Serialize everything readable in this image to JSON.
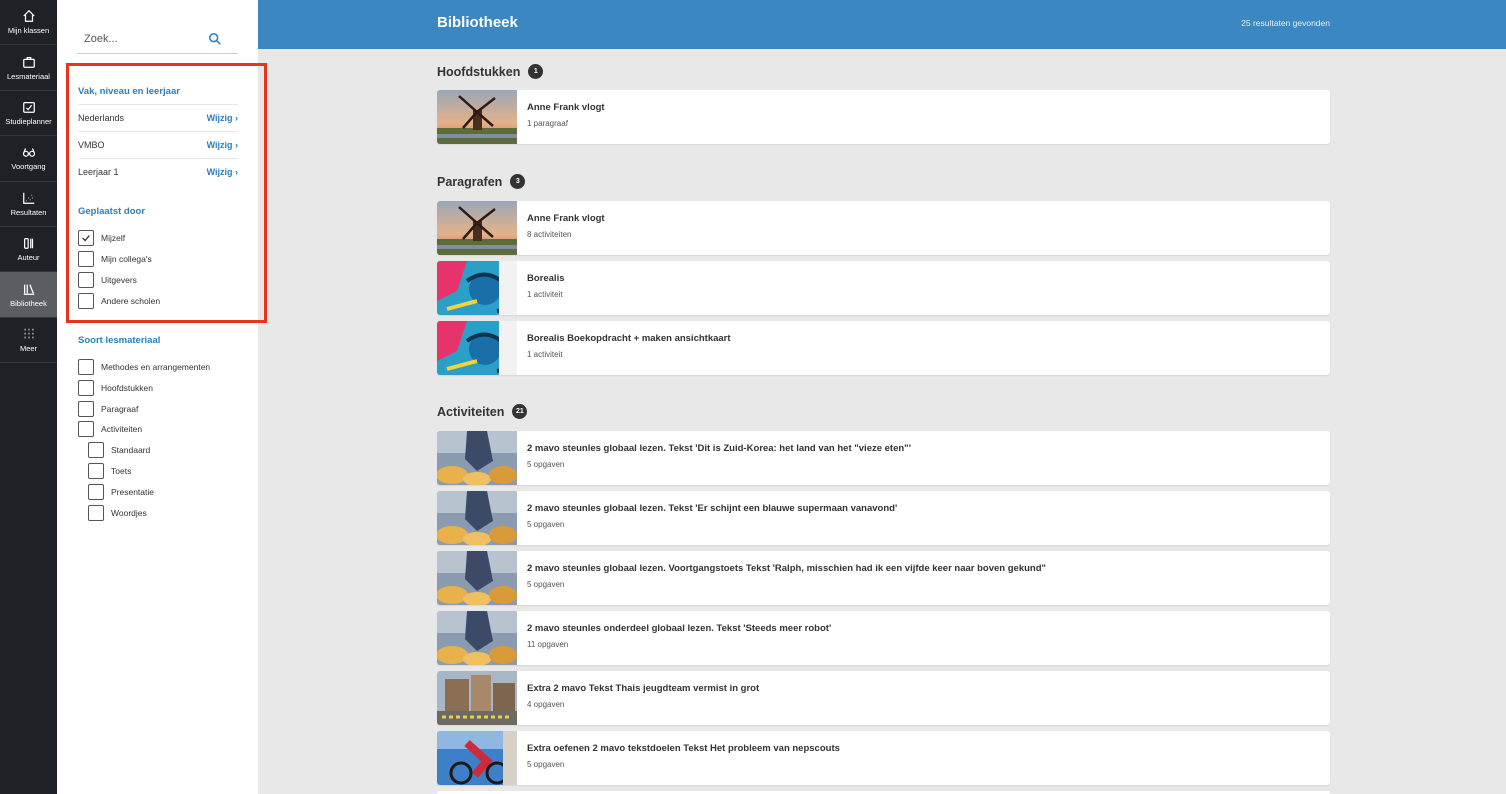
{
  "nav": [
    {
      "label": "Mijn klassen",
      "icon": "home-icon"
    },
    {
      "label": "Lesmateriaal",
      "icon": "briefcase-icon"
    },
    {
      "label": "Studieplanner",
      "icon": "calendar-check-icon"
    },
    {
      "label": "Voortgang",
      "icon": "glasses-icon"
    },
    {
      "label": "Resultaten",
      "icon": "scatter-chart-icon"
    },
    {
      "label": "Auteur",
      "icon": "author-tools-icon"
    },
    {
      "label": "Bibliotheek",
      "icon": "library-icon"
    },
    {
      "label": "Meer",
      "icon": "grid-icon"
    }
  ],
  "search": {
    "placeholder": "Zoek..."
  },
  "filters": {
    "level_title": "Vak, niveau en leerjaar",
    "change_label": "Wijzig ›",
    "levels": [
      "Nederlands",
      "VMBO",
      "Leerjaar 1"
    ],
    "posted_title": "Geplaatst door",
    "posted": [
      {
        "label": "Mijzelf",
        "checked": true
      },
      {
        "label": "Mijn collega's",
        "checked": false
      },
      {
        "label": "Uitgevers",
        "checked": false
      },
      {
        "label": "Andere scholen",
        "checked": false
      }
    ],
    "type_title": "Soort lesmateriaal",
    "types": [
      {
        "label": "Methodes en arrangementen",
        "checked": false
      },
      {
        "label": "Hoofdstukken",
        "checked": false
      },
      {
        "label": "Paragraaf",
        "checked": false
      },
      {
        "label": "Activiteiten",
        "checked": false
      },
      {
        "label": "Standaard",
        "checked": false
      },
      {
        "label": "Toets",
        "checked": false
      },
      {
        "label": "Presentatie",
        "checked": false
      },
      {
        "label": "Woordjes",
        "checked": false
      }
    ]
  },
  "header": {
    "title": "Bibliotheek",
    "results": "25 resultaten gevonden"
  },
  "groups": [
    {
      "title": "Hoofdstukken",
      "count": "1",
      "items": [
        {
          "title": "Anne Frank vlogt",
          "sub": "1 paragraaf",
          "thumb": "windmill"
        }
      ]
    },
    {
      "title": "Paragrafen",
      "count": "3",
      "items": [
        {
          "title": "Anne Frank vlogt",
          "sub": "8 activiteiten",
          "thumb": "windmill"
        },
        {
          "title": "Borealis",
          "sub": "1 activiteit",
          "thumb": "graffiti"
        },
        {
          "title": "Borealis Boekopdracht + maken ansichtkaart",
          "sub": "1 activiteit",
          "thumb": "graffiti"
        }
      ]
    },
    {
      "title": "Activiteiten",
      "count": "21",
      "items": [
        {
          "title": "2 mavo steunles globaal lezen. Tekst 'Dit is Zuid-Korea: het land van het \"vieze eten\"'",
          "sub": "5 opgaven",
          "thumb": "cheese"
        },
        {
          "title": "2 mavo steunles globaal lezen. Tekst 'Er schijnt een blauwe supermaan vanavond'",
          "sub": "5 opgaven",
          "thumb": "cheese"
        },
        {
          "title": "2 mavo steunles globaal lezen. Voortgangstoets Tekst 'Ralph, misschien had ik een vijfde keer naar boven gekund\"",
          "sub": "5 opgaven",
          "thumb": "cheese"
        },
        {
          "title": "2 mavo steunles onderdeel globaal lezen. Tekst 'Steeds meer robot'",
          "sub": "11 opgaven",
          "thumb": "cheese"
        },
        {
          "title": "Extra 2 mavo Tekst Thais jeugdteam vermist in grot",
          "sub": "4 opgaven",
          "thumb": "square"
        },
        {
          "title": "Extra oefenen 2 mavo tekstdoelen Tekst Het probleem van nepscouts",
          "sub": "5 opgaven",
          "thumb": "cyclist"
        }
      ]
    }
  ],
  "colors": {
    "accent": "#3b87c2",
    "rail": "#1e2226",
    "highlight": "#e8341c"
  }
}
